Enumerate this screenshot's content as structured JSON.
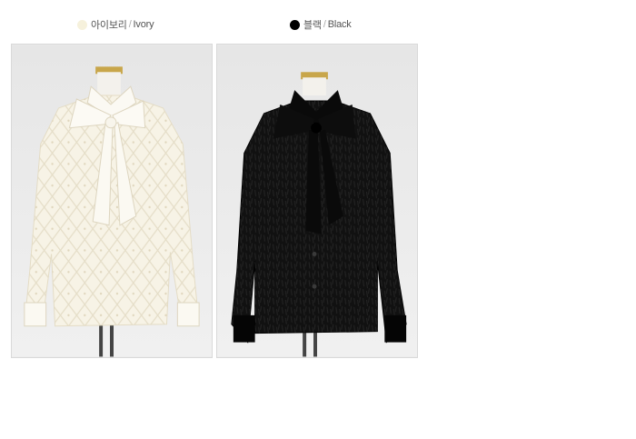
{
  "variants": [
    {
      "name_ko": "아이보리",
      "separator": "/",
      "name_en": "Ivory",
      "color": "#f6f1dc"
    },
    {
      "name_ko": "블랙",
      "separator": "/",
      "name_en": "Black",
      "color": "#000000"
    }
  ]
}
